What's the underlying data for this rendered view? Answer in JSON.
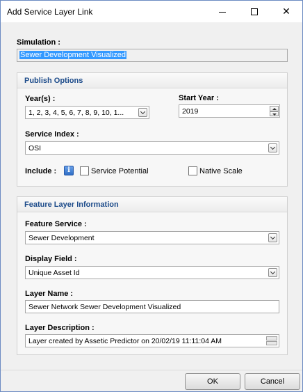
{
  "window": {
    "title": "Add Service Layer Link",
    "minimize_icon": "minimize-icon",
    "maximize_icon": "maximize-icon",
    "close_icon": "close-icon",
    "close_glyph": "✕"
  },
  "simulation": {
    "label": "Simulation :",
    "value": "Sewer Development Visualized"
  },
  "publish_options": {
    "header": "Publish Options",
    "years_label": "Year(s) :",
    "years_value": "1, 2, 3, 4, 5, 6, 7, 8, 9, 10, 1...",
    "start_year_label": "Start Year :",
    "start_year_value": "2019",
    "service_index_label": "Service Index :",
    "service_index_value": "OSI",
    "include_label": "Include :",
    "info_icon_glyph": "i",
    "service_potential_label": "Service Potential",
    "service_potential_checked": false,
    "native_scale_label": "Native Scale",
    "native_scale_checked": false
  },
  "feature_layer": {
    "header": "Feature Layer Information",
    "feature_service_label": "Feature Service :",
    "feature_service_value": "Sewer Development",
    "display_field_label": "Display Field :",
    "display_field_value": "Unique Asset Id",
    "layer_name_label": "Layer Name :",
    "layer_name_value": "Sewer Network Sewer Development Visualized",
    "layer_description_label": "Layer Description :",
    "layer_description_value": "Layer created by Assetic Predictor on 20/02/19 11:11:04 AM"
  },
  "buttons": {
    "ok": "OK",
    "cancel": "Cancel"
  },
  "colors": {
    "group_header_text": "#1c4b8a",
    "selection": "#3399ff",
    "info_icon": "#2f6fc6"
  }
}
